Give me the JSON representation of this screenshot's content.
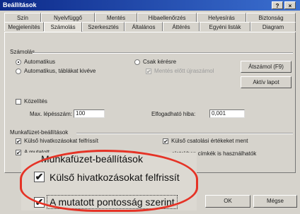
{
  "window": {
    "title": "Beállítások",
    "help_button": "?",
    "close_button": "×"
  },
  "tabs_top": [
    "Szín",
    "Nyelvfüggő",
    "Mentés",
    "Hibaellenőrzés",
    "Helyesírás",
    "Biztonság"
  ],
  "tabs_bottom": [
    "Megjelenítés",
    "Számolás",
    "Szerkesztés",
    "Általános",
    "Áttérés",
    "Egyéni listák",
    "Diagram"
  ],
  "active_tab": "Számolás",
  "calc": {
    "group_label": "Számolás",
    "auto_label": "Automatikus",
    "auto_except_label": "Automatikus, táblákat kivéve",
    "manual_label": "Csak kérésre",
    "save_before_label": "Mentés előtt újraszámol",
    "calc_now_button": "Átszámol (F9)",
    "calc_sheet_button": "Aktív lapot"
  },
  "iteration": {
    "label": "Közelítés",
    "max_label": "Max. lépésszám:",
    "max_value": "100",
    "change_label": "Elfogadható hiba:",
    "change_value": "0,001"
  },
  "workbook": {
    "group_label": "Munkafüzet-beállítások",
    "update_refs_label": "Külső hivatkozásokat felfrissít",
    "precision_label": "A mutatott",
    "save_links_label": "Külső csatolási értékeket ment",
    "accept_labels_label": "...eletekben címkék is használhatók"
  },
  "buttons": {
    "ok": "OK",
    "cancel": "Mégse"
  },
  "zoom": {
    "title": "Munkafüzet-beállítások",
    "item1": "Külső hivatkozásokat felfrissít",
    "item2": "A mutatott pontosság szerint",
    "check": "✔",
    "highlight_color": "#e53326"
  }
}
